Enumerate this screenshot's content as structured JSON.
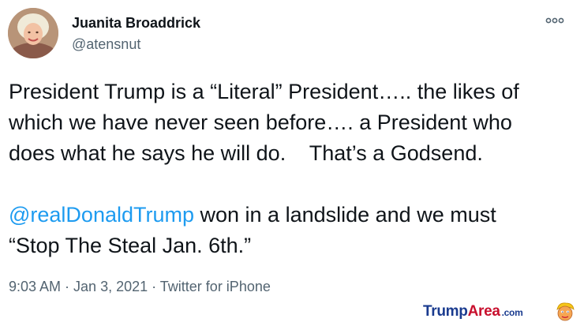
{
  "tweet": {
    "author": {
      "display_name": "Juanita Broaddrick",
      "handle": "@atensnut"
    },
    "more_icon": "more-horizontal-icon",
    "text": {
      "line1": "President Trump is a “Literal” President….. the likes of",
      "line2": "which we have never seen before…. a President who",
      "line3": "does what he says he will do.    That’s a Godsend.",
      "mention": "@realDonaldTrump",
      "line4_rest": " won in a landslide and we must",
      "line5": "“Stop The Steal Jan. 6th.”"
    },
    "meta": {
      "time": "9:03 AM",
      "sep1": " · ",
      "date": "Jan 3, 2021",
      "sep2": " · ",
      "source": "Twitter for iPhone"
    },
    "colors": {
      "text": "#0f1419",
      "secondary": "#536471",
      "link": "#1d9bf0"
    }
  },
  "watermark": {
    "part1": "Trump",
    "part2": "Area",
    "part3": ".com",
    "logo_icon": "trump-cartoon-logo"
  }
}
